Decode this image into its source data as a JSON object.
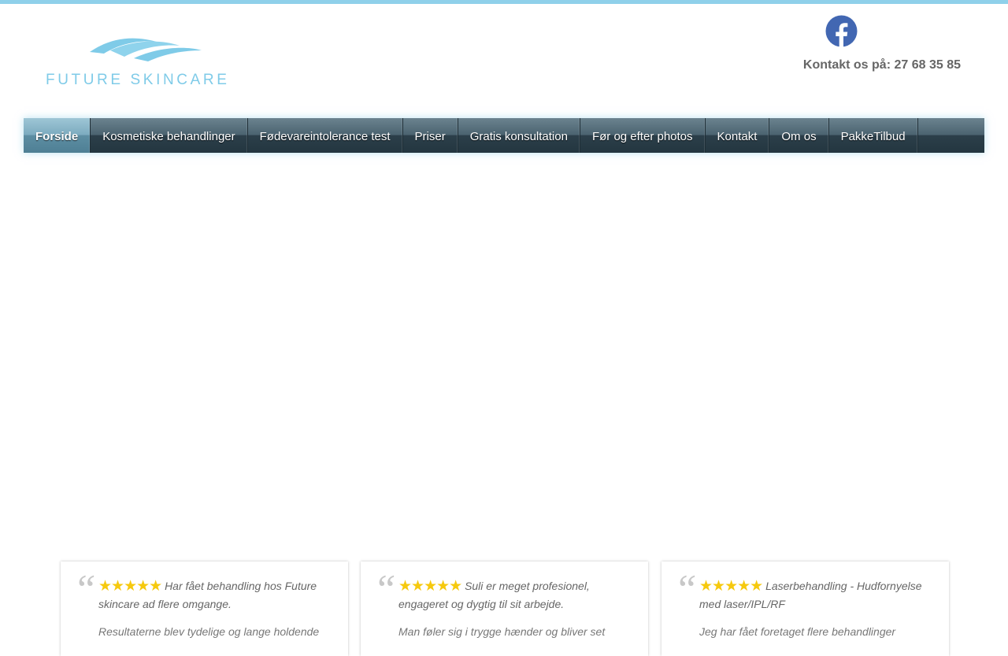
{
  "brand": {
    "name": "FUTURE SKINCARE",
    "logo_icon": "waves-logo-icon",
    "accent": "#7fcbe8"
  },
  "header": {
    "facebook_icon": "facebook-icon",
    "contact_text": "Kontakt os på: 27 68 35 85"
  },
  "nav": {
    "items": [
      {
        "label": "Forside"
      },
      {
        "label": "Kosmetiske behandlinger"
      },
      {
        "label": "Fødevareintolerance test"
      },
      {
        "label": "Priser"
      },
      {
        "label": "Gratis konsultation"
      },
      {
        "label": "Før og efter photos"
      },
      {
        "label": "Kontakt"
      },
      {
        "label": "Om os"
      },
      {
        "label": "PakkeTilbud"
      }
    ]
  },
  "testimonials": [
    {
      "stars": "★★★★★",
      "text": "Har fået behandling hos Future skincare ad flere omgange.",
      "more": "Resultaterne blev tydelige og lange holdende"
    },
    {
      "stars": "★★★★★",
      "text": "Suli er meget profesionel, engageret og dygtig til sit arbejde.",
      "more": "Man føler sig i trygge hænder og bliver set"
    },
    {
      "stars": "★★★★★",
      "text": "Laserbehandling - Hudfornyelse med laser/IPL/RF",
      "more": "Jeg har fået foretaget flere behandlinger"
    }
  ]
}
